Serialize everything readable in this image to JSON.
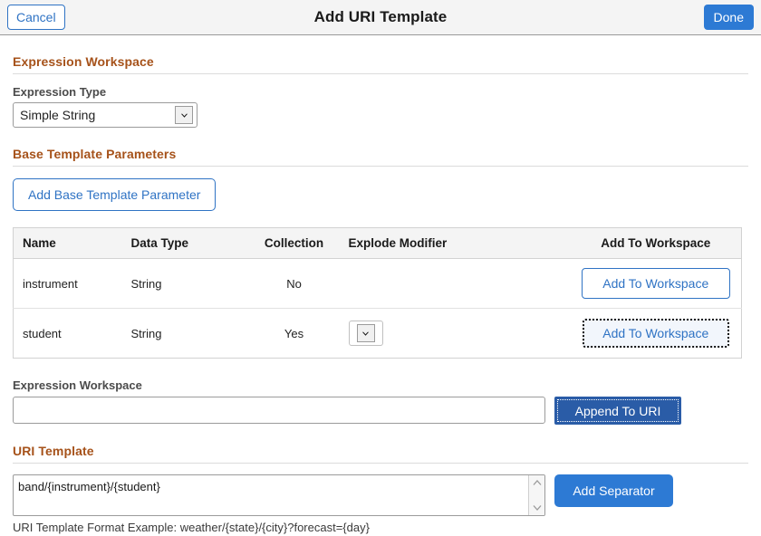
{
  "titlebar": {
    "cancel_label": "Cancel",
    "title": "Add URI Template",
    "done_label": "Done"
  },
  "colors": {
    "section_heading": "#a6521a",
    "link_blue": "#2f73c4",
    "primary_blue": "#2d7ad4",
    "append_blue": "#2a5ca7",
    "header_bg": "#f4f4f4"
  },
  "expression_workspace_section": {
    "heading": "Expression Workspace",
    "expression_type_label": "Expression Type",
    "expression_type_value": "Simple String",
    "expression_type_options": [
      "Simple String"
    ]
  },
  "base_template_parameters_section": {
    "heading": "Base Template Parameters",
    "add_button_label": "Add Base Template Parameter",
    "table": {
      "columns": [
        "Name",
        "Data Type",
        "Collection",
        "Explode Modifier",
        "Add To Workspace"
      ],
      "rows": [
        {
          "name": "instrument",
          "data_type": "String",
          "collection": "No",
          "explode_modifier": "",
          "has_explode_select": false,
          "add_label": "Add To Workspace",
          "focused": false
        },
        {
          "name": "student",
          "data_type": "String",
          "collection": "Yes",
          "explode_modifier": "",
          "has_explode_select": true,
          "add_label": "Add To Workspace",
          "focused": true
        }
      ]
    }
  },
  "workspace_field": {
    "label": "Expression Workspace",
    "value": "",
    "placeholder": "",
    "append_button_label": "Append To URI"
  },
  "uri_template_section": {
    "heading": "URI Template",
    "value": "band/{instrument}/{student}",
    "add_separator_label": "Add Separator",
    "hint": "URI Template Format Example: weather/{state}/{city}?forecast={day}"
  }
}
